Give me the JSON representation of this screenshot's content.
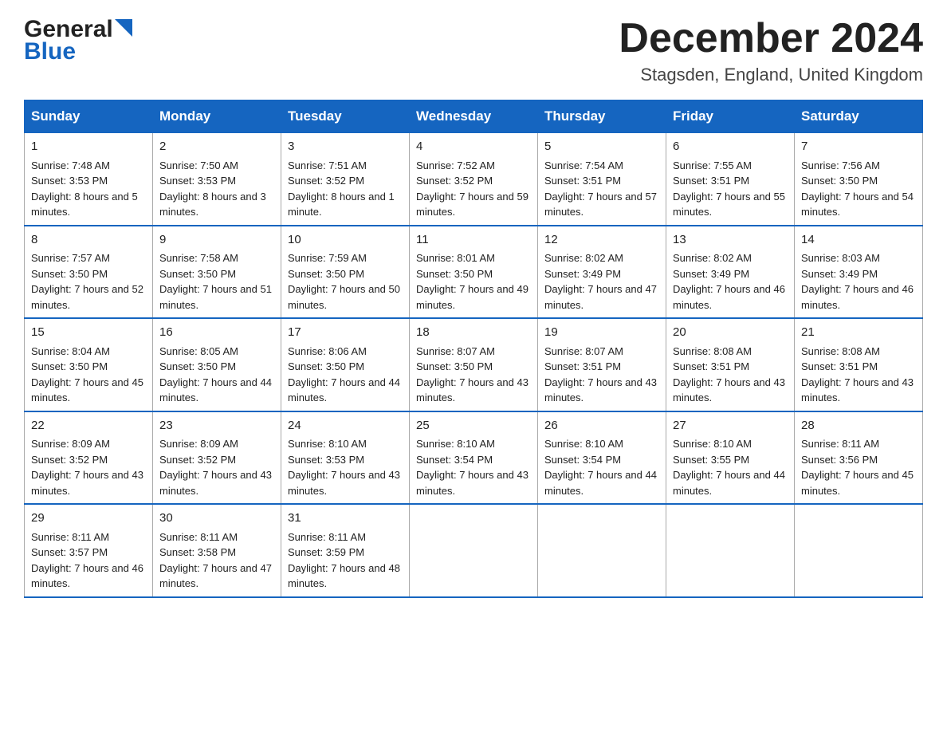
{
  "logo": {
    "general": "General",
    "triangle": "▲",
    "blue": "Blue"
  },
  "header": {
    "month": "December 2024",
    "location": "Stagsden, England, United Kingdom"
  },
  "weekdays": [
    "Sunday",
    "Monday",
    "Tuesday",
    "Wednesday",
    "Thursday",
    "Friday",
    "Saturday"
  ],
  "weeks": [
    [
      {
        "day": "1",
        "sunrise": "7:48 AM",
        "sunset": "3:53 PM",
        "daylight": "8 hours and 5 minutes."
      },
      {
        "day": "2",
        "sunrise": "7:50 AM",
        "sunset": "3:53 PM",
        "daylight": "8 hours and 3 minutes."
      },
      {
        "day": "3",
        "sunrise": "7:51 AM",
        "sunset": "3:52 PM",
        "daylight": "8 hours and 1 minute."
      },
      {
        "day": "4",
        "sunrise": "7:52 AM",
        "sunset": "3:52 PM",
        "daylight": "7 hours and 59 minutes."
      },
      {
        "day": "5",
        "sunrise": "7:54 AM",
        "sunset": "3:51 PM",
        "daylight": "7 hours and 57 minutes."
      },
      {
        "day": "6",
        "sunrise": "7:55 AM",
        "sunset": "3:51 PM",
        "daylight": "7 hours and 55 minutes."
      },
      {
        "day": "7",
        "sunrise": "7:56 AM",
        "sunset": "3:50 PM",
        "daylight": "7 hours and 54 minutes."
      }
    ],
    [
      {
        "day": "8",
        "sunrise": "7:57 AM",
        "sunset": "3:50 PM",
        "daylight": "7 hours and 52 minutes."
      },
      {
        "day": "9",
        "sunrise": "7:58 AM",
        "sunset": "3:50 PM",
        "daylight": "7 hours and 51 minutes."
      },
      {
        "day": "10",
        "sunrise": "7:59 AM",
        "sunset": "3:50 PM",
        "daylight": "7 hours and 50 minutes."
      },
      {
        "day": "11",
        "sunrise": "8:01 AM",
        "sunset": "3:50 PM",
        "daylight": "7 hours and 49 minutes."
      },
      {
        "day": "12",
        "sunrise": "8:02 AM",
        "sunset": "3:49 PM",
        "daylight": "7 hours and 47 minutes."
      },
      {
        "day": "13",
        "sunrise": "8:02 AM",
        "sunset": "3:49 PM",
        "daylight": "7 hours and 46 minutes."
      },
      {
        "day": "14",
        "sunrise": "8:03 AM",
        "sunset": "3:49 PM",
        "daylight": "7 hours and 46 minutes."
      }
    ],
    [
      {
        "day": "15",
        "sunrise": "8:04 AM",
        "sunset": "3:50 PM",
        "daylight": "7 hours and 45 minutes."
      },
      {
        "day": "16",
        "sunrise": "8:05 AM",
        "sunset": "3:50 PM",
        "daylight": "7 hours and 44 minutes."
      },
      {
        "day": "17",
        "sunrise": "8:06 AM",
        "sunset": "3:50 PM",
        "daylight": "7 hours and 44 minutes."
      },
      {
        "day": "18",
        "sunrise": "8:07 AM",
        "sunset": "3:50 PM",
        "daylight": "7 hours and 43 minutes."
      },
      {
        "day": "19",
        "sunrise": "8:07 AM",
        "sunset": "3:51 PM",
        "daylight": "7 hours and 43 minutes."
      },
      {
        "day": "20",
        "sunrise": "8:08 AM",
        "sunset": "3:51 PM",
        "daylight": "7 hours and 43 minutes."
      },
      {
        "day": "21",
        "sunrise": "8:08 AM",
        "sunset": "3:51 PM",
        "daylight": "7 hours and 43 minutes."
      }
    ],
    [
      {
        "day": "22",
        "sunrise": "8:09 AM",
        "sunset": "3:52 PM",
        "daylight": "7 hours and 43 minutes."
      },
      {
        "day": "23",
        "sunrise": "8:09 AM",
        "sunset": "3:52 PM",
        "daylight": "7 hours and 43 minutes."
      },
      {
        "day": "24",
        "sunrise": "8:10 AM",
        "sunset": "3:53 PM",
        "daylight": "7 hours and 43 minutes."
      },
      {
        "day": "25",
        "sunrise": "8:10 AM",
        "sunset": "3:54 PM",
        "daylight": "7 hours and 43 minutes."
      },
      {
        "day": "26",
        "sunrise": "8:10 AM",
        "sunset": "3:54 PM",
        "daylight": "7 hours and 44 minutes."
      },
      {
        "day": "27",
        "sunrise": "8:10 AM",
        "sunset": "3:55 PM",
        "daylight": "7 hours and 44 minutes."
      },
      {
        "day": "28",
        "sunrise": "8:11 AM",
        "sunset": "3:56 PM",
        "daylight": "7 hours and 45 minutes."
      }
    ],
    [
      {
        "day": "29",
        "sunrise": "8:11 AM",
        "sunset": "3:57 PM",
        "daylight": "7 hours and 46 minutes."
      },
      {
        "day": "30",
        "sunrise": "8:11 AM",
        "sunset": "3:58 PM",
        "daylight": "7 hours and 47 minutes."
      },
      {
        "day": "31",
        "sunrise": "8:11 AM",
        "sunset": "3:59 PM",
        "daylight": "7 hours and 48 minutes."
      },
      null,
      null,
      null,
      null
    ]
  ],
  "labels": {
    "sunrise": "Sunrise:",
    "sunset": "Sunset:",
    "daylight": "Daylight:"
  }
}
